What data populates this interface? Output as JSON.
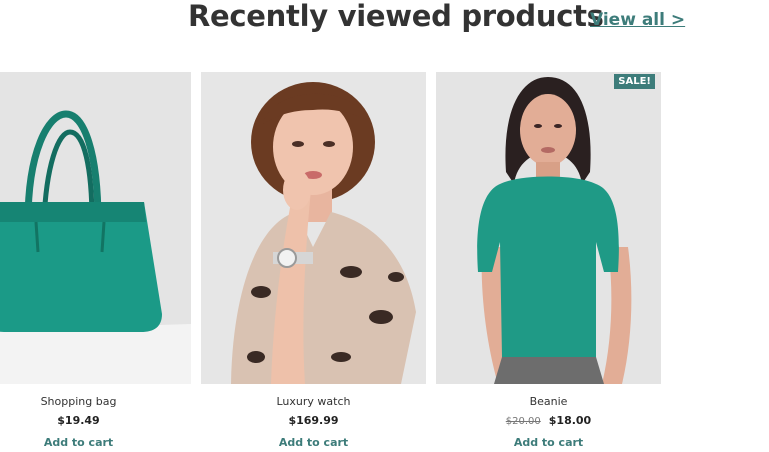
{
  "section": {
    "title": "Recently viewed products",
    "view_all": "View all >"
  },
  "products": [
    {
      "name": "Shopping bag",
      "price": "$19.49",
      "cta": "Add to cart"
    },
    {
      "name": "Luxury watch",
      "price": "$169.99",
      "cta": "Add to cart"
    },
    {
      "name": "Beanie",
      "old_price": "$20.00",
      "price": "$18.00",
      "cta": "Add to cart",
      "badge": "SALE!"
    }
  ],
  "colors": {
    "accent": "#3d7c7a",
    "product_teal": "#1f9a86",
    "image_bg": "#e6e6e6"
  }
}
